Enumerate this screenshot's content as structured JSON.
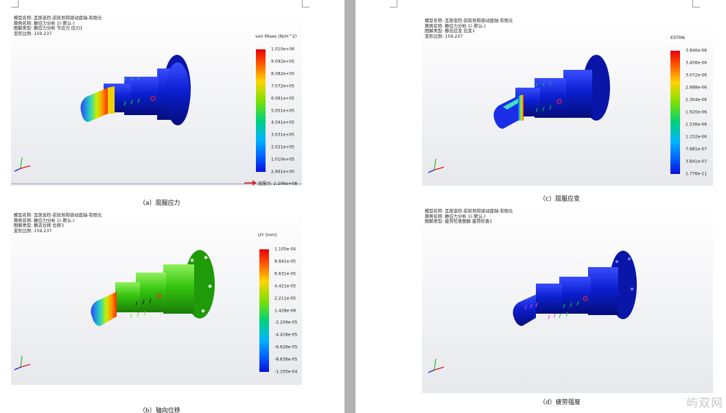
{
  "panels": {
    "a": {
      "model": "模型名称: 瓦斯巡检-前轮刹和驱动盘轴-有限元",
      "study": "算例名称: 静应力分析 1(-默认-)",
      "plot_type": "图解类型: 静应力分析 节应力 应力1",
      "scale": "变形比例: 159.237",
      "unit": "von Mises (N/m^2)",
      "ticks": [
        "1.010e+06",
        "9.092e+05",
        "8.082e+05",
        "7.072e+05",
        "6.061e+05",
        "5.051e+05",
        "4.041e+05",
        "3.031e+05",
        "2.021e+05",
        "1.010e+05",
        "2.661e+00"
      ],
      "yield": "屈服力: 2.206e+08",
      "caption": "（a）屈服应力"
    },
    "b": {
      "model": "模型名称: 瓦斯巡检-前轮刹和驱动盘轴-有限元",
      "study": "算例名称: 静应力分析 1(-默认-)",
      "plot_type": "图解类型: 静态位移 位移3",
      "scale": "变形比例: 159.237",
      "unit": "UY (mm)",
      "ticks": [
        "1.105e-04",
        "8.841e-05",
        "6.631e-05",
        "4.421e-05",
        "2.211e-05",
        "1.428e-08",
        "-2.209e-05",
        "-4.418e-05",
        "-6.628e-05",
        "-8.838e-05",
        "-1.105e-04"
      ],
      "caption": "（b）轴向位移"
    },
    "c": {
      "model": "模型名称: 瓦斯巡检-前轮刹和驱动盘轴-有限元",
      "study": "算例名称: 静应力分析 1(-默认-)",
      "plot_type": "图解类型: 静态应变 应变1",
      "scale": "变形比例: 159.237",
      "unit": "ESTRN",
      "ticks": [
        "3.840e-06",
        "3.456e-06",
        "3.072e-06",
        "2.688e-06",
        "2.304e-06",
        "1.920e-06",
        "1.536e-06",
        "1.152e-06",
        "7.681e-07",
        "3.841e-07",
        "1.776e-11"
      ],
      "caption": "（c）屈服应变"
    },
    "d": {
      "model": "模型名称: 瓦斯巡检-前轮刹和驱动盘轴-有限元",
      "study": "算例名称: 静应力分析 1(-默认-)",
      "plot_type": "图解类型: 疲劳检查图解 疲劳检查1",
      "caption": "（d）疲劳强度"
    }
  },
  "watermark": "屿双网",
  "colors": {
    "shaft_blue": "#0b1fd0",
    "shaft_green": "#34c40f",
    "page_gap": "#b2b2b2"
  }
}
